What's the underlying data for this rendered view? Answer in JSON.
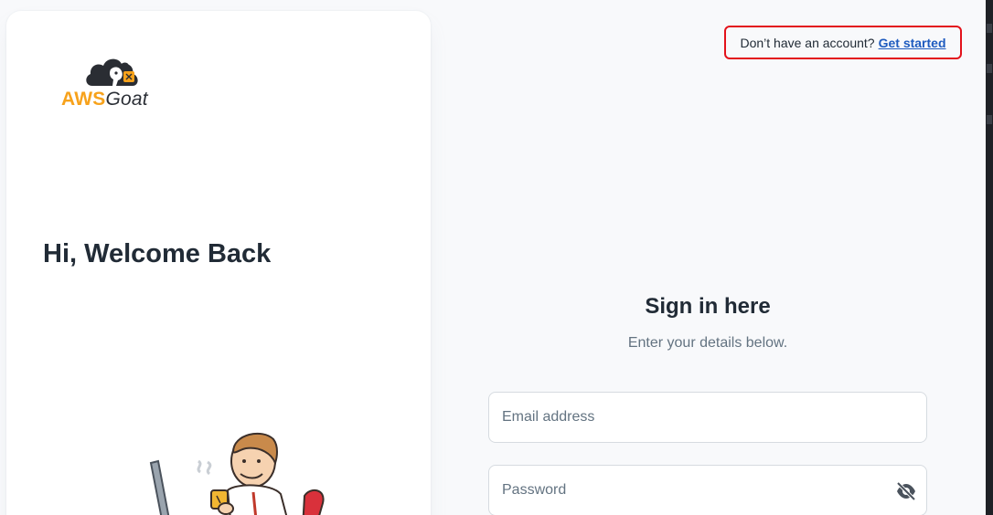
{
  "brand": {
    "logo_aws": "AWS",
    "logo_goat": "Goat",
    "accent_color": "#f7a21b"
  },
  "left_panel": {
    "welcome": "Hi, Welcome Back"
  },
  "header": {
    "prompt": "Don’t have an account?",
    "link_label": "Get started",
    "highlight_color": "#e3121b"
  },
  "form": {
    "title": "Sign in here",
    "subtitle": "Enter your details below.",
    "email_placeholder": "Email address",
    "password_placeholder": "Password",
    "toggle_icon": "eye-off-icon"
  }
}
